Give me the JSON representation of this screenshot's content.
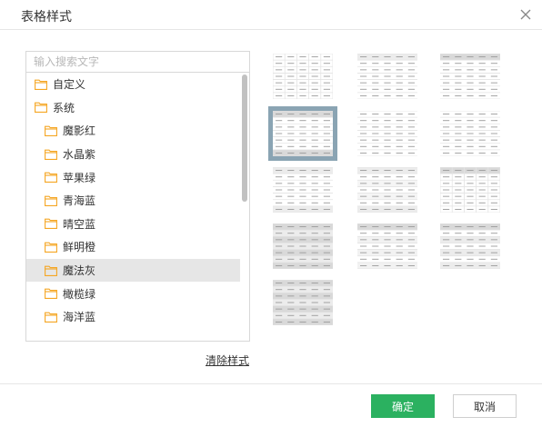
{
  "dialog": {
    "title": "表格样式",
    "close_icon": "close-icon"
  },
  "search": {
    "placeholder": "输入搜索文字"
  },
  "tree": {
    "folder_icon": "folder-icon",
    "folder_color": "#f5a623",
    "items": [
      {
        "label": "自定义",
        "level": 0
      },
      {
        "label": "系统",
        "level": 0
      },
      {
        "label": "魔影红",
        "level": 1
      },
      {
        "label": "水晶紫",
        "level": 1
      },
      {
        "label": "苹果绿",
        "level": 1
      },
      {
        "label": "青海蓝",
        "level": 1
      },
      {
        "label": "晴空蓝",
        "level": 1
      },
      {
        "label": "鲜明橙",
        "level": 1
      },
      {
        "label": "魔法灰",
        "level": 1,
        "selected": true
      },
      {
        "label": "橄榄绿",
        "level": 1
      },
      {
        "label": "海洋蓝",
        "level": 1
      }
    ]
  },
  "clear_style": "清除样式",
  "styles": {
    "selected_index": 3,
    "selected_border_color": "#8aa4b3",
    "header_gray": "#d9d9d9",
    "band_gray": "#ececec",
    "variants": [
      {
        "variant": "grid"
      },
      {
        "variant": "header-light-rows"
      },
      {
        "variant": "header-dark"
      },
      {
        "variant": "header-dark-bottom"
      },
      {
        "variant": "plain"
      },
      {
        "variant": "top-bottom-border"
      },
      {
        "variant": "header-light-bottom"
      },
      {
        "variant": "header-light-bottom-band"
      },
      {
        "variant": "header-dark-grid"
      },
      {
        "variant": "banded"
      },
      {
        "variant": "header-light-band"
      },
      {
        "variant": "header-light-dark-band"
      },
      {
        "variant": "full-banded"
      }
    ]
  },
  "footer": {
    "ok_label": "确定",
    "cancel_label": "取消",
    "ok_color": "#2bb160"
  }
}
